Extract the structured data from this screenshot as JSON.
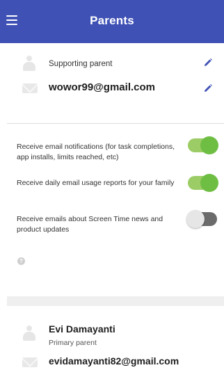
{
  "header": {
    "title": "Parents",
    "menu_icon": "hamburger-menu-icon"
  },
  "parent1": {
    "name": "Supporting parent",
    "email": "wowor99@gmail.com",
    "person_icon": "person-icon",
    "mail_icon": "mail-icon",
    "edit_icon": "pencil-icon"
  },
  "settings": {
    "items": [
      {
        "label": "Receive email notifications (for task completions, app installs, limits reached, etc)",
        "enabled": true
      },
      {
        "label": "Receive daily email usage reports for your family",
        "enabled": true
      },
      {
        "label": "Receive emails about Screen Time news and product updates",
        "enabled": false
      }
    ],
    "help_icon": "question-icon",
    "help_glyph": "?"
  },
  "parent2": {
    "name": "Evi Damayanti",
    "role": "Primary parent",
    "email": "evidamayanti82@gmail.com"
  },
  "colors": {
    "header_bg": "#3f51b5",
    "toggle_on": "#6fbe44",
    "toggle_off": "#6b6b6b",
    "pencil": "#3f51b5"
  }
}
